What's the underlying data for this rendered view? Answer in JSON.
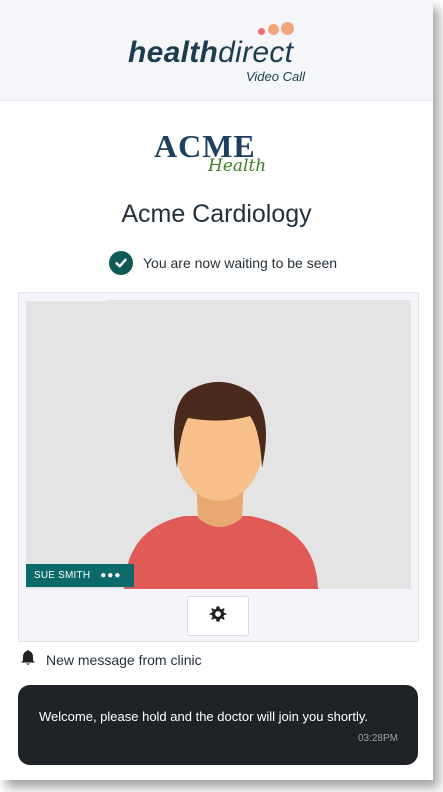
{
  "header": {
    "brand_bold": "health",
    "brand_light": "direct",
    "brand_sub": "Video Call"
  },
  "clinic_logo": {
    "word": "ACME",
    "sub": "Health"
  },
  "clinic_name": "Acme Cardiology",
  "status": {
    "text": "You are now waiting to be seen"
  },
  "video": {
    "participant_name": "SUE SMITH",
    "indicator": "●●●"
  },
  "controls": {
    "settings_icon": "gear-icon"
  },
  "notification": {
    "icon": "bell-icon",
    "text": "New message from clinic"
  },
  "message": {
    "text": "Welcome, please hold and the doctor will join you shortly.",
    "time": "03:28PM"
  },
  "colors": {
    "brand_dark": "#1d3d4f",
    "dot_orange": "#f2a57a",
    "dot_pink": "#ef6f6f",
    "status_green": "#0f5a55",
    "name_tag": "#0c6b6a",
    "message_bg": "#1f2227"
  }
}
